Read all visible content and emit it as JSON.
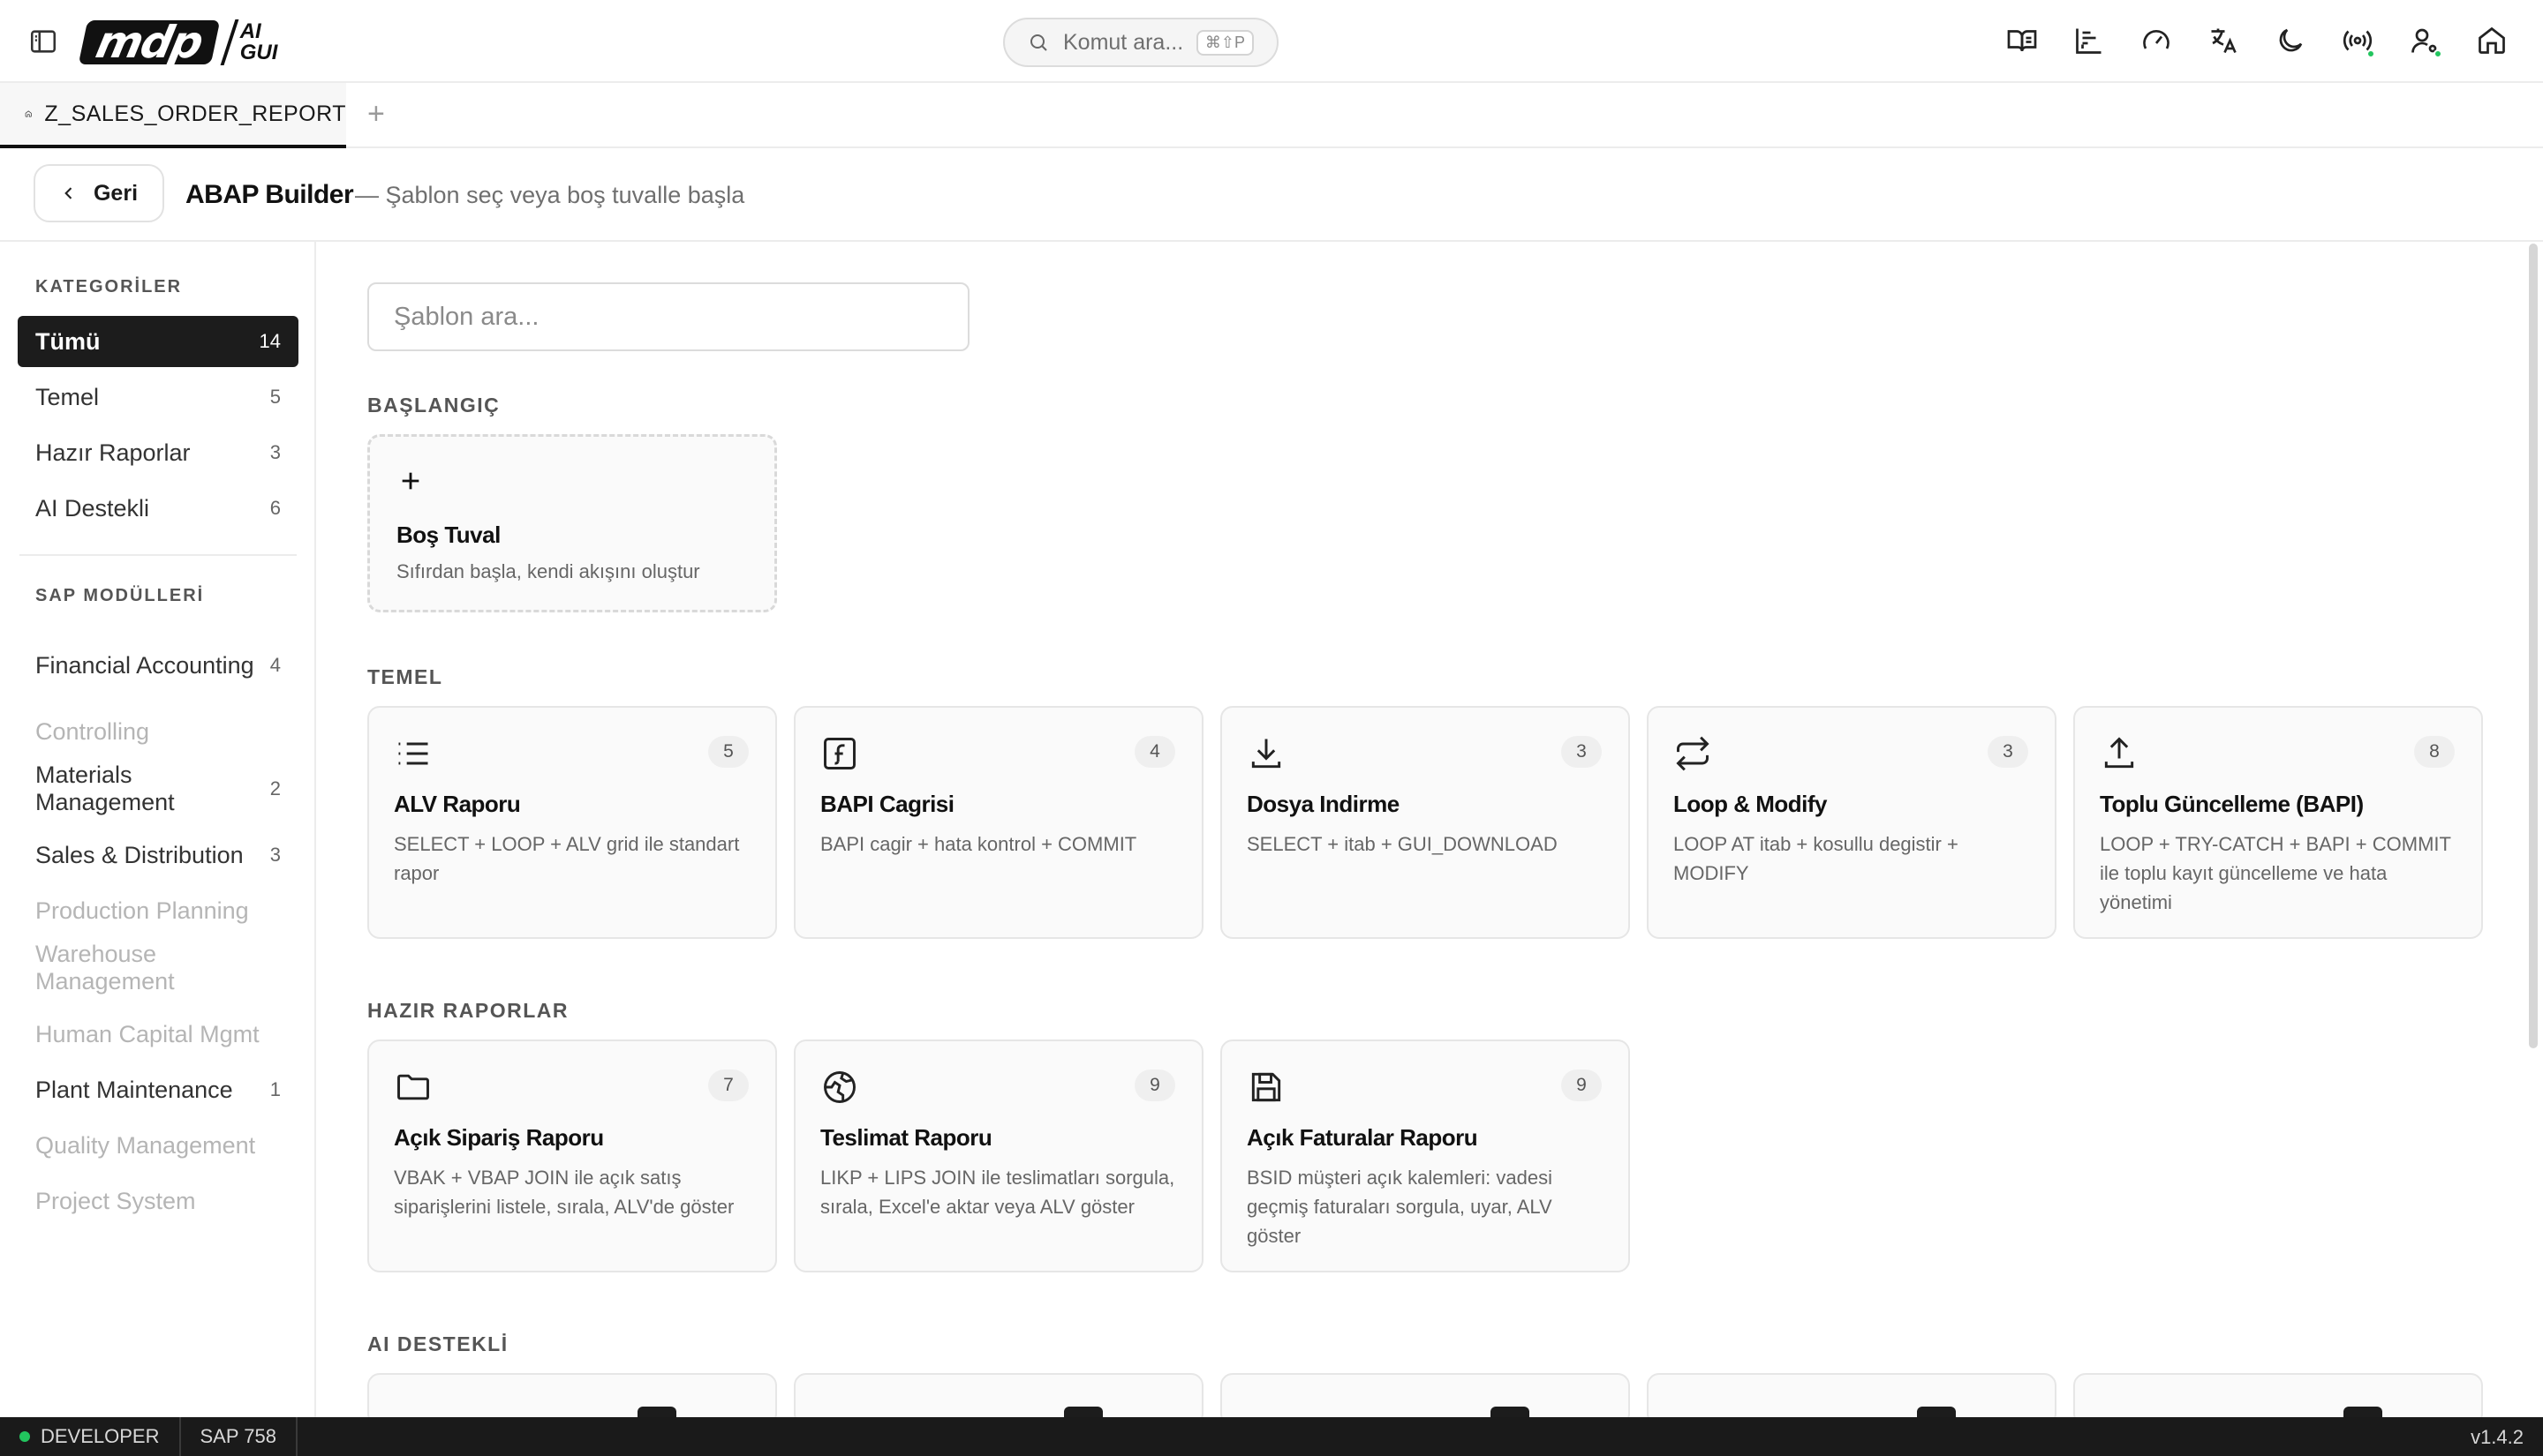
{
  "logo": {
    "main": "mdp",
    "ai_top": "AI",
    "ai_bottom": "GUI"
  },
  "command_search": {
    "placeholder": "Komut ara...",
    "shortcut": "⌘⇧P"
  },
  "top_icons": [
    "book-icon",
    "chart-icon",
    "gauge-icon",
    "translate-icon",
    "moon-icon",
    "broadcast-icon",
    "user-settings-icon",
    "home-icon"
  ],
  "tabs": [
    {
      "label": "Z_SALES_ORDER_REPORT",
      "icon": "home-icon"
    }
  ],
  "header": {
    "back_label": "Geri",
    "title": "ABAP Builder",
    "subtitle": "— Şablon seç veya boş tuvalle başla"
  },
  "sidebar": {
    "categories_heading": "KATEGORİLER",
    "categories": [
      {
        "label": "Tümü",
        "count": "14",
        "active": true
      },
      {
        "label": "Temel",
        "count": "5"
      },
      {
        "label": "Hazır Raporlar",
        "count": "3"
      },
      {
        "label": "AI Destekli",
        "count": "6"
      }
    ],
    "modules_heading": "SAP MODÜLLERİ",
    "modules": [
      {
        "label": "Financial Accounting",
        "count": "4"
      },
      {
        "label": "Controlling",
        "count": "",
        "muted": true
      },
      {
        "label": "Materials Management",
        "count": "2"
      },
      {
        "label": "Sales & Distribution",
        "count": "3"
      },
      {
        "label": "Production Planning",
        "count": "",
        "muted": true
      },
      {
        "label": "Warehouse Management",
        "count": "",
        "muted": true
      },
      {
        "label": "Human Capital Mgmt",
        "count": "",
        "muted": true
      },
      {
        "label": "Plant Maintenance",
        "count": "1"
      },
      {
        "label": "Quality Management",
        "count": "",
        "muted": true
      },
      {
        "label": "Project System",
        "count": "",
        "muted": true
      }
    ]
  },
  "main": {
    "search_placeholder": "Şablon ara...",
    "start": {
      "title": "BAŞLANGIÇ",
      "blank": {
        "title": "Boş Tuval",
        "desc": "Sıfırdan başla, kendi akışını oluştur"
      }
    },
    "basic": {
      "title": "TEMEL",
      "cards": [
        {
          "title": "ALV Raporu",
          "desc": "SELECT + LOOP + ALV grid ile standart rapor",
          "count": "5",
          "icon": "list-icon"
        },
        {
          "title": "BAPI Cagrisi",
          "desc": "BAPI cagir + hata kontrol + COMMIT",
          "count": "4",
          "icon": "function-icon"
        },
        {
          "title": "Dosya Indirme",
          "desc": "SELECT + itab + GUI_DOWNLOAD",
          "count": "3",
          "icon": "download-icon"
        },
        {
          "title": "Loop & Modify",
          "desc": "LOOP AT itab + kosullu degistir + MODIFY",
          "count": "3",
          "icon": "repeat-icon"
        },
        {
          "title": "Toplu Güncelleme (BAPI)",
          "desc": "LOOP + TRY-CATCH + BAPI + COMMIT ile toplu kayıt güncelleme ve hata yönetimi",
          "count": "8",
          "icon": "upload-icon"
        }
      ]
    },
    "reports": {
      "title": "HAZIR RAPORLAR",
      "cards": [
        {
          "title": "Açık Sipariş Raporu",
          "desc": "VBAK + VBAP JOIN ile açık satış siparişlerini listele, sırala, ALV'de göster",
          "count": "7",
          "icon": "folder-icon"
        },
        {
          "title": "Teslimat Raporu",
          "desc": "LIKP + LIPS JOIN ile teslimatları sorgula, sırala, Excel'e aktar veya ALV göster",
          "count": "9",
          "icon": "globe-icon"
        },
        {
          "title": "Açık Faturalar Raporu",
          "desc": "BSID müşteri açık kalemleri: vadesi geçmiş faturaları sorgula, uyar, ALV göster",
          "count": "9",
          "icon": "save-icon"
        }
      ]
    },
    "ai": {
      "title": "AI DESTEKLİ"
    }
  },
  "status": {
    "mode": "DEVELOPER",
    "system": "SAP 758",
    "version": "v1.4.2"
  }
}
